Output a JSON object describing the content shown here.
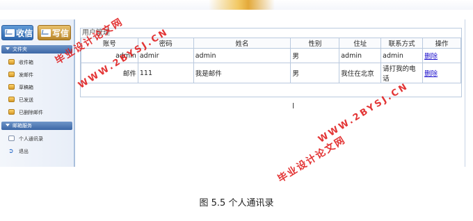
{
  "toolbar": {
    "receive_label": "收信",
    "write_label": "写信"
  },
  "sidebar": {
    "folders_title": "文件夹",
    "folders": [
      {
        "label": "收件箱",
        "icon": "inbox-icon"
      },
      {
        "label": "发邮件",
        "icon": "send-mail-icon"
      },
      {
        "label": "草稿箱",
        "icon": "drafts-icon"
      },
      {
        "label": "已发送",
        "icon": "sent-icon"
      },
      {
        "label": "已删除邮件",
        "icon": "deleted-icon"
      }
    ],
    "service_title": "邮箱服务",
    "services": [
      {
        "label": "个人通讯录",
        "icon": "contacts-icon"
      },
      {
        "label": "退出",
        "icon": "logout-icon"
      }
    ]
  },
  "panel": {
    "title": "用户管理",
    "columns": [
      "账号",
      "密码",
      "姓名",
      "性别",
      "住址",
      "联系方式",
      "操作"
    ],
    "rows": [
      {
        "account": "admin",
        "password": "admir",
        "name": "admin",
        "gender": "男",
        "address": "admin",
        "contact": "admin",
        "action": "删除"
      },
      {
        "account": "邮件",
        "password": "111",
        "name": "我是邮件",
        "gender": "男",
        "address": "我住在北京",
        "contact": "请打我的电话",
        "action": "删除"
      }
    ]
  },
  "watermark": {
    "text_cn": "毕业设计论文网",
    "text_url": "WWW.2BYSJ.CN"
  },
  "caption": "图 5.5  个人通讯录",
  "colors": {
    "accent_blue": "#2e66ad",
    "accent_gold": "#b9862a",
    "watermark_red": "#e02020",
    "link": "#1a0dcc"
  }
}
